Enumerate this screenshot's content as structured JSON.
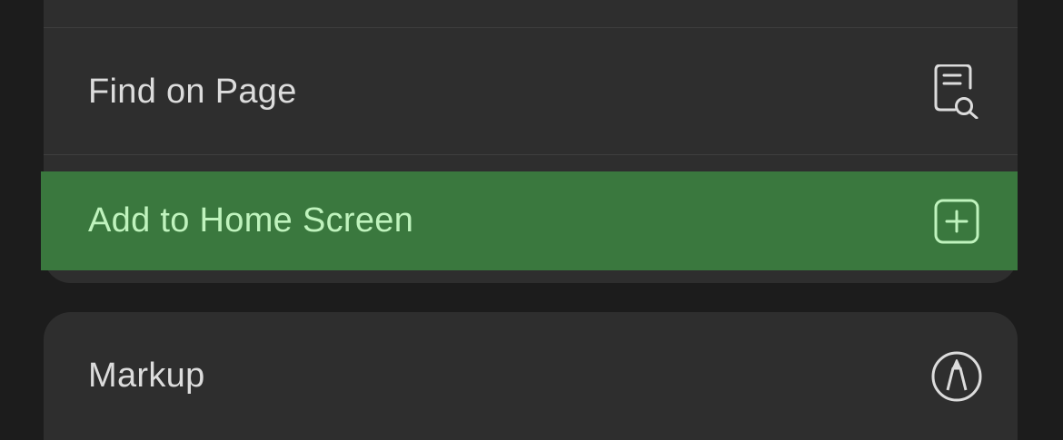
{
  "menu": {
    "items": [
      {
        "label": "Find on Page",
        "icon": "doc-search-icon",
        "highlighted": false
      },
      {
        "label": "Add to Home Screen",
        "icon": "plus-square-icon",
        "highlighted": true
      },
      {
        "label": "Markup",
        "icon": "markup-pen-icon",
        "highlighted": false
      }
    ]
  },
  "colors": {
    "background": "#1c1c1c",
    "card": "#2e2e2e",
    "highlight": "#3a783e",
    "highlight_text": "#bff3bd",
    "text": "#dcdcdc"
  }
}
